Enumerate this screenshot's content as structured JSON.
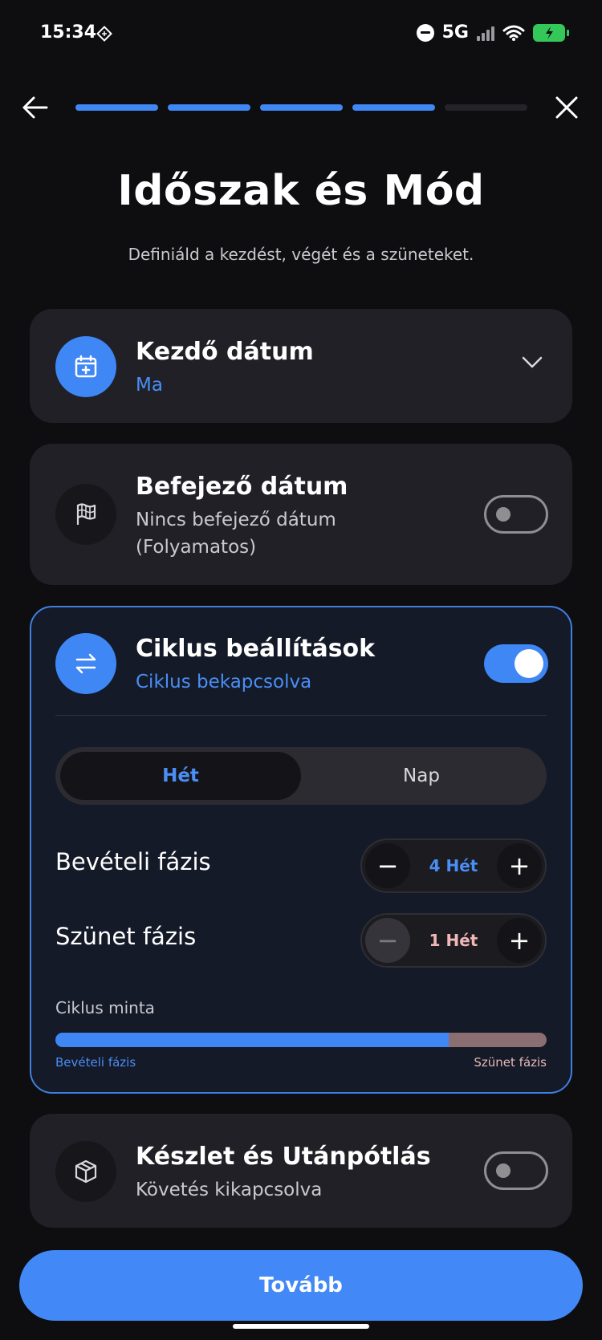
{
  "status_bar": {
    "time": "15:34",
    "network": "5G"
  },
  "progress": {
    "completed_steps": 4,
    "total_steps": 5
  },
  "header": {
    "title": "Időszak és Mód",
    "subtitle": "Definiáld a kezdést, végét és a szüneteket."
  },
  "start_date": {
    "title": "Kezdő dátum",
    "value": "Ma"
  },
  "end_date": {
    "title": "Befejező dátum",
    "subtitle_line1": "Nincs befejező dátum",
    "subtitle_line2": "(Folyamatos)",
    "enabled": false
  },
  "cycle": {
    "title": "Ciklus beállítások",
    "subtitle": "Ciklus bekapcsolva",
    "enabled": true,
    "units": [
      "Hét",
      "Nap"
    ],
    "selected_unit": "Hét",
    "intake_phase": {
      "label": "Bevételi fázis",
      "value": "4 Hét",
      "amount": 4
    },
    "break_phase": {
      "label": "Szünet fázis",
      "value": "1 Hét",
      "amount": 1
    },
    "pattern": {
      "label": "Ciklus minta",
      "intake_legend": "Bevételi fázis",
      "break_legend": "Szünet fázis"
    }
  },
  "inventory": {
    "title": "Készlet és Utánpótlás",
    "subtitle": "Követés kikapcsolva",
    "enabled": false
  },
  "next_button": {
    "label": "Tovább"
  },
  "colors": {
    "accent": "#3f87f5",
    "background": "#0e0e10",
    "card": "#202026",
    "break_phase": "#8a6e72"
  }
}
